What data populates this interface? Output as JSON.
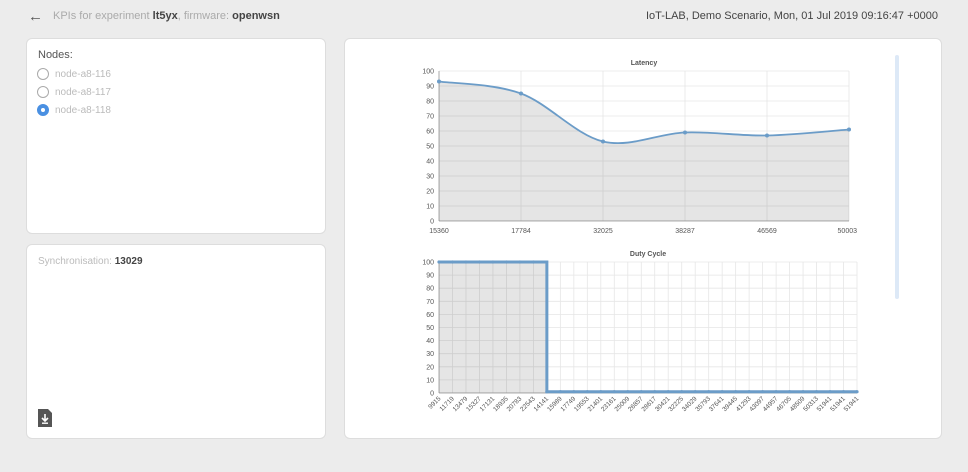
{
  "header": {
    "back_icon": "arrow-left-icon",
    "prefix": "KPIs for experiment",
    "experiment": "lt5yx",
    "sep": ", firmware:",
    "firmware": "openwsn",
    "scenario": "IoT-LAB, Demo Scenario, Mon, 01 Jul 2019 09:16:47 +0000"
  },
  "nodes": {
    "title": "Nodes:",
    "items": [
      {
        "label": "node-a8-116",
        "selected": false
      },
      {
        "label": "node-a8-117",
        "selected": false
      },
      {
        "label": "node-a8-118",
        "selected": true
      }
    ]
  },
  "sync": {
    "label": "Synchronisation:",
    "value": "13029",
    "download_icon": "file-download-icon"
  },
  "colors": {
    "accent": "#4a90e2",
    "line": "#6b9cc8"
  },
  "chart_data": [
    {
      "type": "area",
      "title": "Latency",
      "x": [
        15360,
        17784,
        32025,
        38287,
        46569,
        50003
      ],
      "categories": [
        "15360",
        "17784",
        "32025",
        "38287",
        "46569",
        "50003"
      ],
      "values": [
        93,
        85,
        53,
        59,
        57,
        61
      ],
      "ylim": [
        0,
        100
      ],
      "yticks": [
        0,
        10,
        20,
        30,
        40,
        50,
        60,
        70,
        80,
        90,
        100
      ],
      "grid": true
    },
    {
      "type": "area",
      "title": "Duty Cycle",
      "categories": [
        "9915",
        "11719",
        "13479",
        "15327",
        "17131",
        "18935",
        "20783",
        "22543",
        "14141",
        "15989",
        "17749",
        "19553",
        "21401",
        "23161",
        "25009",
        "26857",
        "28617",
        "30421",
        "32225",
        "34029",
        "35793",
        "37641",
        "39445",
        "41293",
        "43097",
        "44957",
        "46705",
        "48509",
        "50313",
        "51941",
        "51941",
        "51941"
      ],
      "values": [
        100,
        100,
        100,
        100,
        100,
        100,
        100,
        100,
        1,
        1,
        1,
        1,
        1,
        1,
        1,
        1,
        1,
        1,
        1,
        1,
        1,
        1,
        1,
        1,
        1,
        1,
        1,
        1,
        1,
        1,
        1,
        1
      ],
      "ylim": [
        0,
        100
      ],
      "yticks": [
        0,
        10,
        20,
        30,
        40,
        50,
        60,
        70,
        80,
        90,
        100
      ],
      "grid": true
    }
  ]
}
